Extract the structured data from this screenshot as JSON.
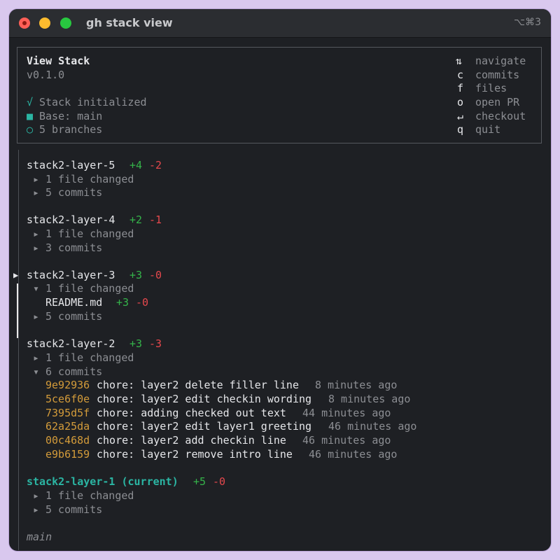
{
  "window": {
    "title": "gh stack view",
    "shortcut": "⌥⌘3"
  },
  "header": {
    "title": "View Stack",
    "version": "v0.1.0",
    "status": [
      {
        "icon": "√",
        "text": "Stack initialized"
      },
      {
        "icon": "■",
        "text": "Base: main"
      },
      {
        "icon": "○",
        "text": "5 branches"
      }
    ],
    "keys": [
      {
        "key": "⇅",
        "action": "navigate"
      },
      {
        "key": "c",
        "action": "commits"
      },
      {
        "key": "f",
        "action": "files"
      },
      {
        "key": "o",
        "action": "open PR"
      },
      {
        "key": "↵",
        "action": "checkout"
      },
      {
        "key": "q",
        "action": "quit"
      }
    ]
  },
  "branches": [
    {
      "name": "stack2-layer-5",
      "added": "+4",
      "removed": "-2",
      "files": "1 file changed",
      "commits": "5 commits"
    },
    {
      "name": "stack2-layer-4",
      "added": "+2",
      "removed": "-1",
      "files": "1 file changed",
      "commits": "3 commits"
    },
    {
      "name": "stack2-layer-3",
      "added": "+3",
      "removed": "-0",
      "files": "1 file changed",
      "file_list": [
        {
          "name": "README.md",
          "added": "+3",
          "removed": "-0"
        }
      ],
      "commits": "5 commits",
      "selected_marker": "▶"
    },
    {
      "name": "stack2-layer-2",
      "added": "+3",
      "removed": "-3",
      "files": "1 file changed",
      "commits": "6 commits",
      "commit_list": [
        {
          "hash": "9e92936",
          "msg": "chore: layer2 delete filler line",
          "time": "8 minutes ago"
        },
        {
          "hash": "5ce6f0e",
          "msg": "chore: layer2 edit checkin wording",
          "time": "8 minutes ago"
        },
        {
          "hash": "7395d5f",
          "msg": "chore: adding checked out text",
          "time": "44 minutes ago"
        },
        {
          "hash": "62a25da",
          "msg": "chore: layer2 edit layer1 greeting",
          "time": "46 minutes ago"
        },
        {
          "hash": "00c468d",
          "msg": "chore: layer2 add checkin line",
          "time": "46 minutes ago"
        },
        {
          "hash": "e9b6159",
          "msg": "chore: layer2 remove intro line",
          "time": "46 minutes ago"
        }
      ]
    },
    {
      "name": "stack2-layer-1 (current)",
      "added": "+5",
      "removed": "-0",
      "files": "1 file changed",
      "commits": "5 commits"
    }
  ],
  "base": "main",
  "glyphs": {
    "collapsed": "▸",
    "expanded": "▾"
  }
}
